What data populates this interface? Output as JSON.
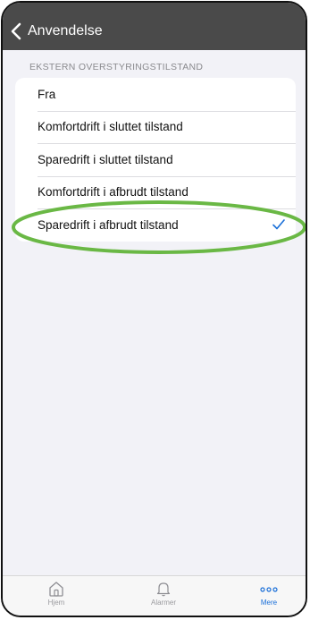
{
  "navbar": {
    "back_label": "Anvendelse"
  },
  "section": {
    "header": "EKSTERN OVERSTYRINGSTILSTAND",
    "options": [
      {
        "label": "Fra",
        "selected": false
      },
      {
        "label": "Komfortdrift i sluttet tilstand",
        "selected": false
      },
      {
        "label": "Sparedrift i sluttet tilstand",
        "selected": false
      },
      {
        "label": "Komfortdrift i afbrudt tilstand",
        "selected": false
      },
      {
        "label": "Sparedrift i afbrudt tilstand",
        "selected": true
      }
    ]
  },
  "tabbar": {
    "tabs": [
      {
        "label": "Hjem",
        "icon": "home-icon",
        "active": false
      },
      {
        "label": "Alarmer",
        "icon": "bell-icon",
        "active": false
      },
      {
        "label": "Mere",
        "icon": "more-dots-icon",
        "active": true
      }
    ]
  },
  "colors": {
    "navbar": "#4a4a4a",
    "accent": "#1a6fd8",
    "highlight": "#6ab845",
    "background": "#f2f2f7"
  }
}
